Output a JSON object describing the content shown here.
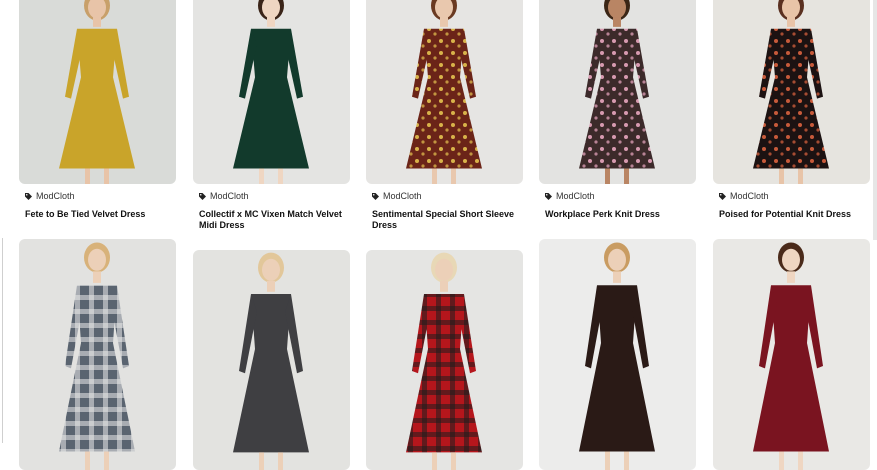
{
  "products_row1": [
    {
      "brand": "ModCloth",
      "title": "Fete to Be Tied Velvet Dress",
      "bg": "#d9dbd8",
      "dress": "#c9a42a",
      "accent": "#b08b1e",
      "skin": "#e8c4a8",
      "hair": "#c8a06a"
    },
    {
      "brand": "ModCloth",
      "title": "Collectif x MC Vixen Match Velvet Midi Dress",
      "bg": "#e4e4e2",
      "dress": "#123a2c",
      "accent": "#0b2a1f",
      "skin": "#efd6c2",
      "hair": "#3a2418"
    },
    {
      "brand": "ModCloth",
      "title": "Sentimental Special Short Sleeve Dress",
      "bg": "#e6e5e3",
      "dress": "#6b2418",
      "accent": "#d8b24a",
      "skin": "#e9c8ae",
      "hair": "#6a3a22"
    },
    {
      "brand": "ModCloth",
      "title": "Workplace Perk Knit Dress",
      "bg": "#e3e3e1",
      "dress": "#3c2a2a",
      "accent": "#d79ab0",
      "skin": "#b98564",
      "hair": "#3b2616"
    },
    {
      "brand": "ModCloth",
      "title": "Poised for Potential Knit Dress",
      "bg": "#e6e4df",
      "dress": "#1c1212",
      "accent": "#c85a3a",
      "skin": "#e8c4a8",
      "hair": "#5a3020"
    }
  ],
  "products_row2": [
    {
      "dress": "#5a6470",
      "accent": "#e7e7e7",
      "bg": "#e2e2e0",
      "skin": "#ecd0b8",
      "hair": "#d8b27a"
    },
    {
      "dress": "#3f3f42",
      "accent": "#f3f3f3",
      "bg": "#e3e3e0",
      "skin": "#ecd0b8",
      "hair": "#e2c79a"
    },
    {
      "dress": "#b5161c",
      "accent": "#1d1d1d",
      "bg": "#e5e5e3",
      "skin": "#ecd0b8",
      "hair": "#e8d8b6"
    },
    {
      "dress": "#2a1a16",
      "accent": "#e0b38a",
      "bg": "#ececeb",
      "skin": "#ecd0b8",
      "hair": "#c99c62"
    },
    {
      "dress": "#7a1420",
      "accent": "#5a0c16",
      "bg": "#e9e8e5",
      "skin": "#efd6c2",
      "hair": "#4a2a1a"
    }
  ]
}
